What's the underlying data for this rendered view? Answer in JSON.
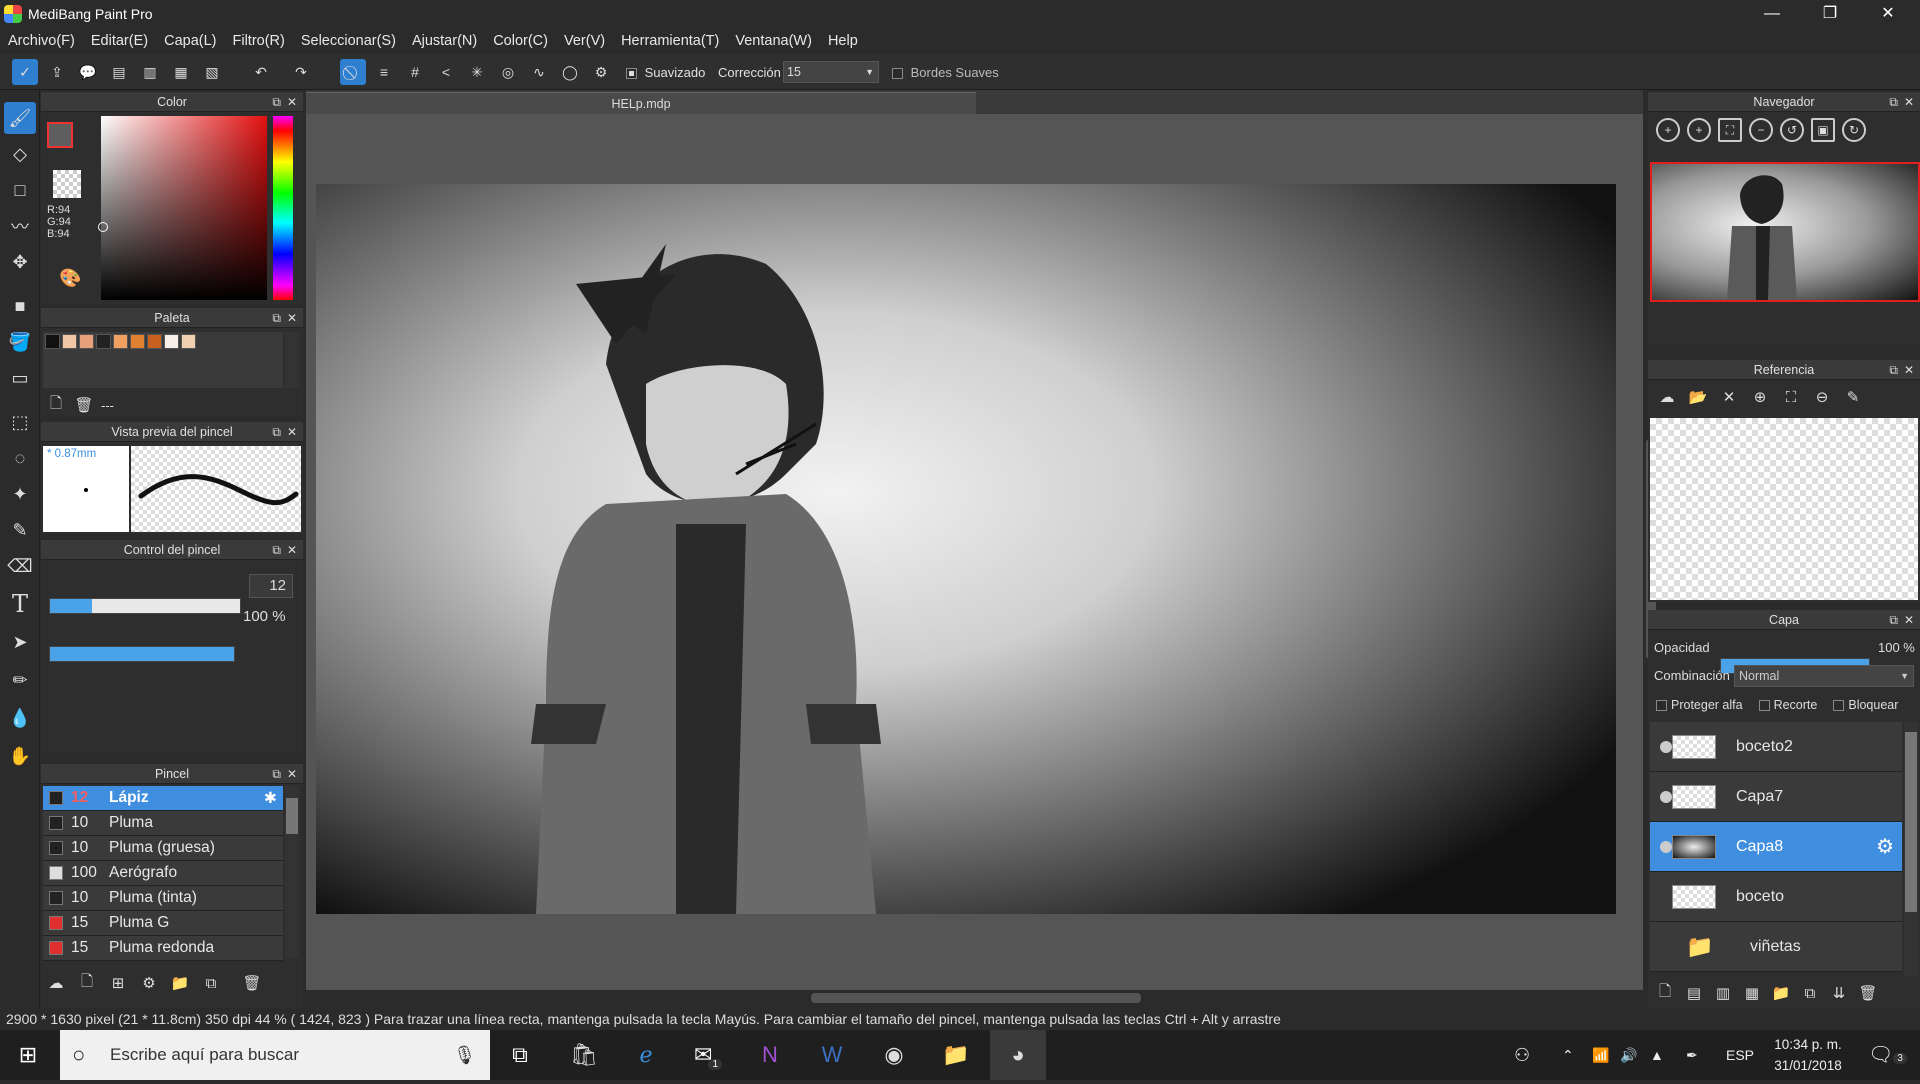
{
  "window": {
    "title": "MediBang Paint Pro",
    "minimize": "—",
    "restore": "❐",
    "close": "✕"
  },
  "menu": [
    "Archivo(F)",
    "Editar(E)",
    "Capa(L)",
    "Filtro(R)",
    "Seleccionar(S)",
    "Ajustar(N)",
    "Color(C)",
    "Ver(V)",
    "Herramienta(T)",
    "Ventana(W)",
    "Help"
  ],
  "toolbar": {
    "smoothing_label": "Suavizado",
    "correction_label": "Corrección",
    "correction_value": "15",
    "soft_edges_label": "Bordes Suaves"
  },
  "document": {
    "tab_title": "HELp.mdp"
  },
  "color_panel": {
    "title": "Color",
    "r": "R:94",
    "g": "G:94",
    "b": "B:94",
    "foreground": "#5e5e5e"
  },
  "palette_panel": {
    "title": "Paleta",
    "name": "---",
    "swatches": [
      "#111111",
      "#f0c8a8",
      "#e8a07a",
      "#222222",
      "#f0a060",
      "#e08030",
      "#c86020",
      "#f8f0e8",
      "#f0d0b0"
    ]
  },
  "brush_preview_panel": {
    "title": "Vista previa del pincel",
    "size_label": "* 0.87mm"
  },
  "brush_control_panel": {
    "title": "Control del pincel",
    "size_value": "12",
    "size_fraction": 0.22,
    "opacity_value": "100 %",
    "opacity_fraction": 1.0
  },
  "brush_panel": {
    "title": "Pincel",
    "items": [
      {
        "size": "12",
        "name": "Lápiz",
        "color": "#222222",
        "selected": true
      },
      {
        "size": "10",
        "name": "Pluma",
        "color": "#222222"
      },
      {
        "size": "10",
        "name": "Pluma (gruesa)",
        "color": "#222222"
      },
      {
        "size": "100",
        "name": "Aerógrafo",
        "color": "#dddddd"
      },
      {
        "size": "10",
        "name": "Pluma (tinta)",
        "color": "#222222"
      },
      {
        "size": "15",
        "name": "Pluma G",
        "color": "#e03030"
      },
      {
        "size": "15",
        "name": "Pluma redonda",
        "color": "#e03030"
      }
    ]
  },
  "navigator_panel": {
    "title": "Navegador"
  },
  "reference_panel": {
    "title": "Referencia"
  },
  "layer_panel": {
    "title": "Capa",
    "opacity_label": "Opacidad",
    "opacity_value": "100 %",
    "opacity_fraction": 1.0,
    "blend_label": "Combinación",
    "blend_value": "Normal",
    "protect_alpha": "Proteger alfa",
    "clipping": "Recorte",
    "lock": "Bloquear",
    "layers": [
      {
        "name": "boceto2",
        "visible": true
      },
      {
        "name": "Capa7",
        "visible": true
      },
      {
        "name": "Capa8",
        "visible": true,
        "selected": true
      },
      {
        "name": "boceto",
        "visible": false
      },
      {
        "name": "viñetas",
        "folder": true
      }
    ]
  },
  "status": {
    "size": "2900 * 1630 pixel",
    "physical": "(21 * 11.8cm)",
    "dpi": "350 dpi",
    "zoom": "44 %",
    "coords": "( 1424, 823 )",
    "hint": "Para trazar una línea recta, mantenga pulsada la tecla Mayús. Para cambiar el tamaño del pincel, mantenga pulsada las teclas Ctrl + Alt y arrastre"
  },
  "taskbar": {
    "search_placeholder": "Escribe aquí para buscar",
    "lang": "ESP",
    "time": "10:34 p. m.",
    "date": "31/01/2018",
    "mail_badge": "1",
    "notif_badge": "3"
  },
  "colors": {
    "accent": "#3f8ee0",
    "panel": "#2e2e2e",
    "header": "#3a3a3a"
  }
}
